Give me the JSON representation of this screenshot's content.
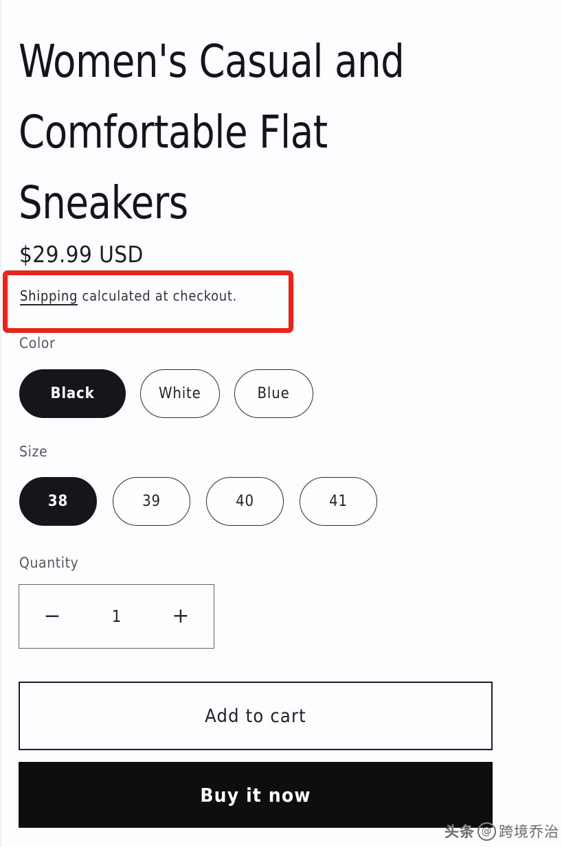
{
  "product": {
    "title": "Women's Casual and Comfortable Flat Sneakers",
    "price": "$29.99 USD",
    "shipping_link_label": "Shipping",
    "shipping_note_rest": " calculated at checkout."
  },
  "options": {
    "color": {
      "label": "Color",
      "selected": "Black",
      "values": [
        "Black",
        "White",
        "Blue"
      ]
    },
    "size": {
      "label": "Size",
      "selected": "38",
      "values": [
        "38",
        "39",
        "40",
        "41"
      ]
    },
    "quantity": {
      "label": "Quantity",
      "value": "1",
      "decrease_icon": "minus-icon",
      "decrease_glyph": "−",
      "increase_icon": "plus-icon",
      "increase_glyph": "+"
    }
  },
  "actions": {
    "add_to_cart_label": "Add to cart",
    "buy_it_now_label": "Buy it now"
  },
  "annotation": {
    "type": "highlight-rectangle",
    "target": "shipping-note",
    "color": "#e8251b"
  },
  "watermark": {
    "mark": "头条",
    "at": "@",
    "handle": "跨境乔治"
  },
  "colors": {
    "background": "#fbfdfe",
    "text_primary": "#1d1d26",
    "text_muted": "#57575f",
    "selected_fill": "#16161a",
    "annotation_red": "#e8251b"
  }
}
